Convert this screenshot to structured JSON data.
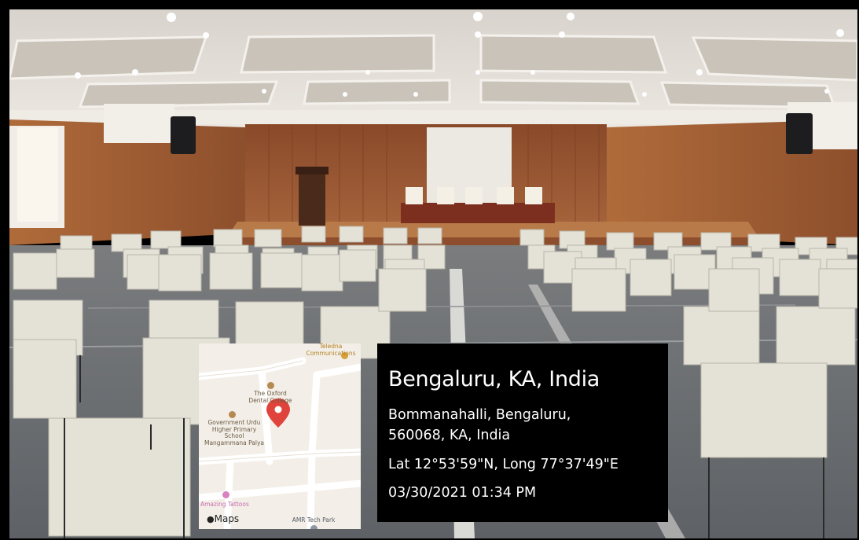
{
  "photo": {
    "description_icon": "auditorium-photo",
    "colors": {
      "wall": "#9a5530",
      "ceiling": "#e2ddd6",
      "floor": "#6f7479",
      "chair": "#e9e6dc"
    }
  },
  "map": {
    "pois": [
      {
        "name": "Teledna\nCommunications",
        "icon": "pin-circle-icon",
        "color": "#d6a13a"
      },
      {
        "name": "The Oxford\nDental College",
        "icon": "pin-circle-icon",
        "color": "#b58a52"
      },
      {
        "name": "Government Urdu\nHigher Primary\nSchool\nMangammana Palya",
        "icon": "pin-circle-icon",
        "color": "#b58a52"
      },
      {
        "name": "Amazing Tattoos",
        "icon": "pin-circle-icon",
        "color": "#d883c0"
      },
      {
        "name": "AMR Tech Park",
        "icon": "pin-circle-icon",
        "color": "#8f96a3"
      }
    ],
    "brand": "Maps",
    "marker_color": "#e0433b"
  },
  "location": {
    "city": "Bengaluru, KA, India",
    "address_line1": "Bommanahalli, Bengaluru,",
    "address_line2": "560068, KA, India",
    "coordinates": "Lat 12°53'59\"N, Long 77°37'49\"E",
    "timestamp": "03/30/2021 01:34 PM"
  }
}
